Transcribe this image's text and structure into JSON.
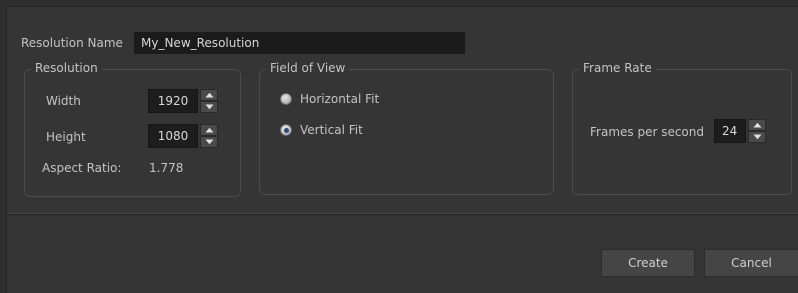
{
  "resolution_name": {
    "label": "Resolution Name",
    "value": "My_New_Resolution"
  },
  "resolution_group": {
    "title": "Resolution",
    "width": {
      "label": "Width",
      "value": "1920"
    },
    "height": {
      "label": "Height",
      "value": "1080"
    },
    "aspect_ratio": {
      "label": "Aspect Ratio:",
      "value": "1.778"
    }
  },
  "field_of_view_group": {
    "title": "Field of View",
    "options": [
      {
        "label": "Horizontal Fit",
        "selected": false
      },
      {
        "label": "Vertical Fit",
        "selected": true
      }
    ]
  },
  "frame_rate_group": {
    "title": "Frame Rate",
    "fps": {
      "label": "Frames per second",
      "value": "24"
    }
  },
  "buttons": {
    "create": "Create",
    "cancel": "Cancel"
  },
  "icons": {
    "spin_up": "arrow-up-icon",
    "spin_down": "arrow-down-icon"
  },
  "colors": {
    "background": "#353535",
    "input_bg": "#1b1b1b",
    "button_bg": "#454545",
    "radio_selected_dot": "#2b4b7a"
  }
}
